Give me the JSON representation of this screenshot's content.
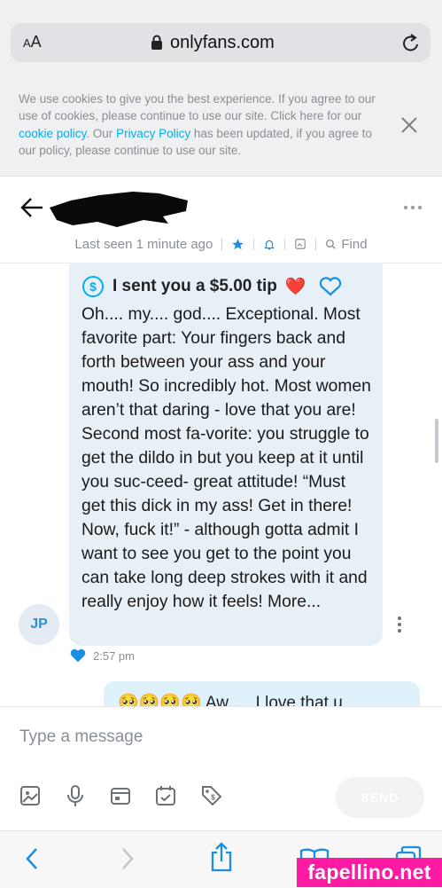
{
  "browser": {
    "aa_label": "AA",
    "url": "onlyfans.com"
  },
  "cookie_banner": {
    "text_before": "We use cookies to give you the best experience. If you agree to our use of cookies, please continue to use our site. Click here for our ",
    "link_cookie": "cookie policy",
    "text_middle": ". Our ",
    "link_privacy": "Privacy Policy",
    "text_after": " has been updated, if you agree to our policy, please continue to use our site."
  },
  "chat_header": {
    "last_seen": "Last seen 1 minute ago",
    "find_label": "Find"
  },
  "message": {
    "tip_label": "I sent you a $5.00 tip",
    "tip_emoji": "❤️",
    "text": "Oh.... my.... god.... Exceptional. Most favorite part: Your fingers back and forth between your ass and your mouth! So incredibly hot. Most women aren’t that daring - love that you are! Second most fa-vorite: you struggle to get the dildo in but you keep at it until you suc-ceed- great attitude! “Must get this dick in my ass! Get in there! Now, fuck it!” - although gotta admit I want to see you get to the point you can take long deep strokes with it and really enjoy how it feels! More...",
    "avatar_initials": "JP",
    "time": "2:57 pm"
  },
  "outgoing": {
    "text": "🥺🥺🥺🥺 Aw..... I love that u"
  },
  "composer": {
    "placeholder": "Type a message",
    "send_label": "SEND"
  },
  "watermark": "fapellino.net",
  "colors": {
    "accent": "#00aff0",
    "bubble": "#e8f0f7",
    "outgoing_bubble": "#dff2fb",
    "watermark": "#ff1aa3"
  }
}
